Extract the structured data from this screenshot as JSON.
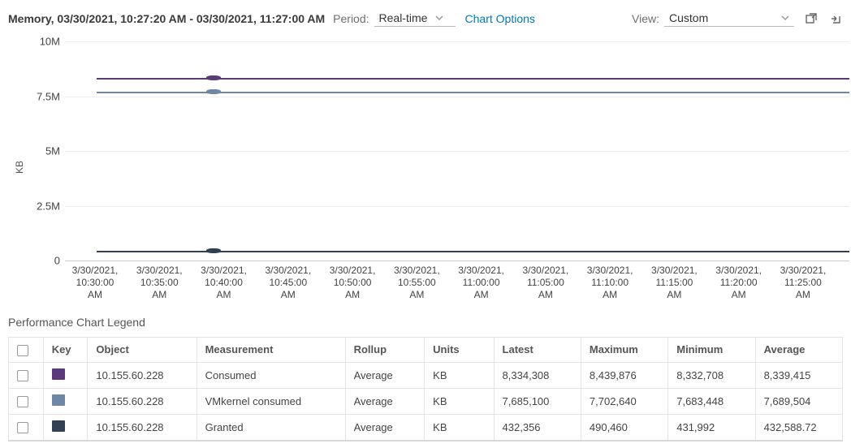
{
  "header": {
    "title": "Memory, 03/30/2021, 10:27:20 AM - 03/30/2021, 11:27:00 AM",
    "period_label": "Period:",
    "period_value": "Real-time",
    "chart_options": "Chart Options",
    "view_label": "View:",
    "view_value": "Custom"
  },
  "chart_data": {
    "type": "line",
    "ylabel": "KB",
    "y_ticks": [
      "0",
      "2.5M",
      "5M",
      "7.5M",
      "10M"
    ],
    "ylim": [
      0,
      10000000
    ],
    "x_ticks": [
      "3/30/2021, 10:30:00 AM",
      "3/30/2021, 10:35:00 AM",
      "3/30/2021, 10:40:00 AM",
      "3/30/2021, 10:45:00 AM",
      "3/30/2021, 10:50:00 AM",
      "3/30/2021, 10:55:00 AM",
      "3/30/2021, 11:00:00 AM",
      "3/30/2021, 11:05:00 AM",
      "3/30/2021, 11:10:00 AM",
      "3/30/2021, 11:15:00 AM",
      "3/30/2021, 11:20:00 AM",
      "3/30/2021, 11:25:00 AM"
    ],
    "series": [
      {
        "name": "Consumed",
        "object": "10.155.60.228",
        "color": "#5b3a7a",
        "approx_value": 8335000
      },
      {
        "name": "VMkernel consumed",
        "object": "10.155.60.228",
        "color": "#6f87a4",
        "approx_value": 7690000
      },
      {
        "name": "Granted",
        "object": "10.155.60.228",
        "color": "#324055",
        "approx_value": 440000
      }
    ],
    "title": ""
  },
  "legend": {
    "title": "Performance Chart Legend",
    "columns": {
      "key": "Key",
      "object": "Object",
      "measurement": "Measurement",
      "rollup": "Rollup",
      "units": "Units",
      "latest": "Latest",
      "maximum": "Maximum",
      "minimum": "Minimum",
      "average": "Average"
    },
    "rows": [
      {
        "color": "#5b3a7a",
        "object": "10.155.60.228",
        "measurement": "Consumed",
        "rollup": "Average",
        "units": "KB",
        "latest": "8,334,308",
        "maximum": "8,439,876",
        "minimum": "8,332,708",
        "average": "8,339,415"
      },
      {
        "color": "#6f87a4",
        "object": "10.155.60.228",
        "measurement": "VMkernel consumed",
        "rollup": "Average",
        "units": "KB",
        "latest": "7,685,100",
        "maximum": "7,702,640",
        "minimum": "7,683,448",
        "average": "7,689,504"
      },
      {
        "color": "#324055",
        "object": "10.155.60.228",
        "measurement": "Granted",
        "rollup": "Average",
        "units": "KB",
        "latest": "432,356",
        "maximum": "490,460",
        "minimum": "431,992",
        "average": "432,588.72"
      }
    ]
  }
}
